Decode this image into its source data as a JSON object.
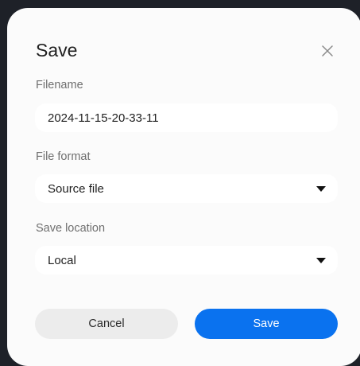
{
  "dialog": {
    "title": "Save",
    "close_icon": "close-icon"
  },
  "filename": {
    "label": "Filename",
    "value": "2024-11-15-20-33-11"
  },
  "file_format": {
    "label": "File format",
    "value": "Source file",
    "dropdown_icon": "caret-down-icon"
  },
  "save_location": {
    "label": "Save location",
    "value": "Local",
    "dropdown_icon": "caret-down-icon"
  },
  "actions": {
    "cancel_label": "Cancel",
    "save_label": "Save"
  },
  "colors": {
    "primary": "#0a72ef",
    "dialog_background": "#fbfbfb",
    "backdrop": "#1e2128"
  }
}
